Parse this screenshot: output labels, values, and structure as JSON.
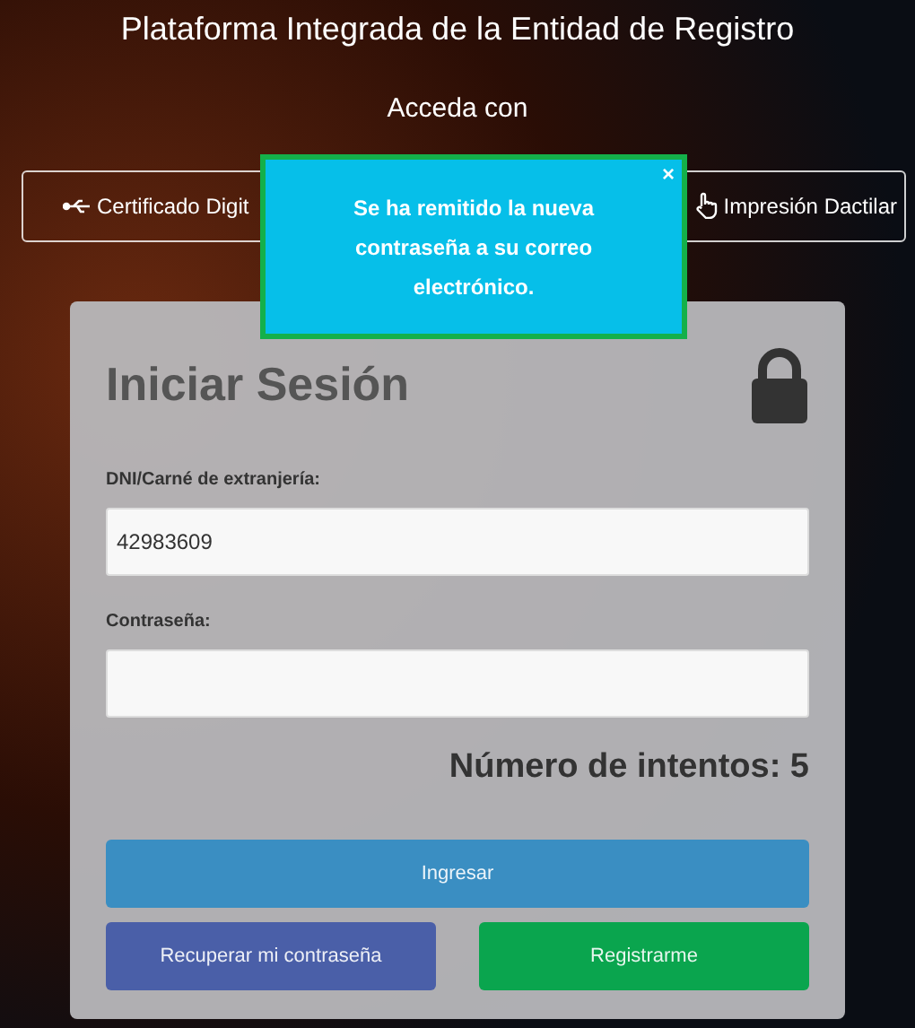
{
  "header": {
    "title": "Plataforma Integrada de la Entidad de Registro",
    "subtitle": "Acceda con"
  },
  "methods": [
    {
      "kind": "usb",
      "label": "Certificado Digit"
    },
    {
      "kind": "hand",
      "label": "Impresión Dactilar"
    }
  ],
  "alert": {
    "message": "Se ha remitido la nueva contraseña a su correo electrónico.",
    "close": "×"
  },
  "login": {
    "title": "Iniciar Sesión",
    "fields": [
      {
        "label": "DNI/Carné de extranjería:",
        "value": "42983609"
      },
      {
        "label": "Contraseña:"
      }
    ],
    "attempts": "Número de intentos: 5",
    "buttons": [
      {
        "kind": "primary",
        "label": "Ingresar"
      },
      {
        "kind": "recover",
        "label": "Recuperar mi contraseña"
      },
      {
        "kind": "register",
        "label": "Registrarme"
      }
    ]
  }
}
